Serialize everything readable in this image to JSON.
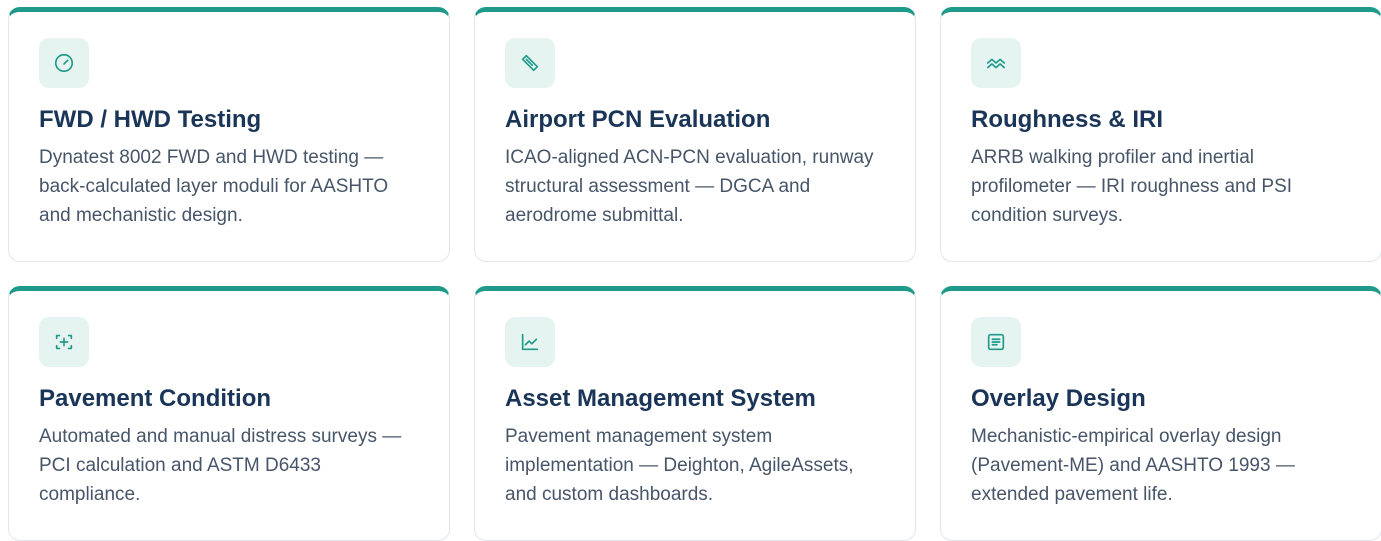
{
  "colors": {
    "accent": "#1f9a8a",
    "icon_bg": "#e6f4f1",
    "title": "#1a3558",
    "body_text": "#475569",
    "border": "#e2e6ea"
  },
  "cards": [
    {
      "icon": "gauge-icon",
      "title": "FWD / HWD Testing",
      "description": "Dynatest 8002 FWD and HWD testing — back-calculated layer moduli for AASHTO and mechanistic design."
    },
    {
      "icon": "ruler-icon",
      "title": "Airport PCN Evaluation",
      "description": "ICAO-aligned ACN-PCN evaluation, runway structural assessment — DGCA and aerodrome submittal."
    },
    {
      "icon": "waves-icon",
      "title": "Roughness & IRI",
      "description": "ARRB walking profiler and inertial profilometer — IRI roughness and PSI condition surveys."
    },
    {
      "icon": "scan-plus-icon",
      "title": "Pavement Condition",
      "description": "Automated and manual distress surveys — PCI calculation and ASTM D6433 compliance."
    },
    {
      "icon": "line-chart-icon",
      "title": "Asset Management System",
      "description": "Pavement management system implementation — Deighton, AgileAssets, and custom dashboards."
    },
    {
      "icon": "document-icon",
      "title": "Overlay Design",
      "description": "Mechanistic-empirical overlay design (Pavement-ME) and AASHTO 1993 — extended pavement life."
    }
  ]
}
